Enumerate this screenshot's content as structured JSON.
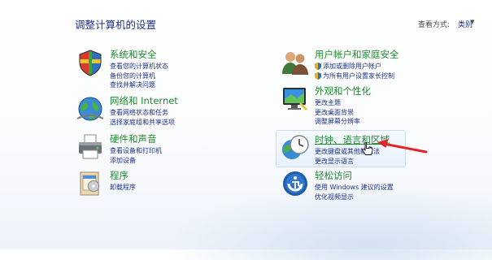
{
  "page": {
    "title": "调整计算机的设置"
  },
  "view": {
    "label": "查看方式:",
    "value": "类别",
    "arrow": "▼"
  },
  "categories_left": [
    {
      "title": "系统和安全",
      "links": [
        "查看您的计算机状态",
        "备份您的计算机",
        "查找并解决问题"
      ],
      "icon": "shield-icon"
    },
    {
      "title": "网络和 Internet",
      "links": [
        "查看网络状态和任务",
        "选择家庭组和共享选项"
      ],
      "icon": "network-globe-icon"
    },
    {
      "title": "硬件和声音",
      "links": [
        "查看设备和打印机",
        "添加设备"
      ],
      "icon": "printer-icon"
    },
    {
      "title": "程序",
      "links": [
        "卸载程序"
      ],
      "icon": "programs-icon"
    }
  ],
  "categories_right": [
    {
      "title": "用户帐户和家庭安全",
      "links": [
        "添加或删除用户帐户",
        "为所有用户设置家长控制"
      ],
      "icon": "users-icon"
    },
    {
      "title": "外观和个性化",
      "links": [
        "更改主题",
        "更改桌面背景",
        "调整屏幕分辨率"
      ],
      "icon": "display-icon"
    },
    {
      "title": "时钟、语言和区域",
      "links": [
        "更改键盘或其他输入法",
        "更改显示语言"
      ],
      "icon": "clock-globe-icon"
    },
    {
      "title": "轻松访问",
      "links": [
        "使用 Windows 建议的设置",
        "优化视频显示"
      ],
      "icon": "ease-of-access-icon"
    }
  ],
  "colors": {
    "title_green": "#1f8a2e",
    "link_blue": "#1e3287",
    "annotation_red": "#e0242a"
  }
}
